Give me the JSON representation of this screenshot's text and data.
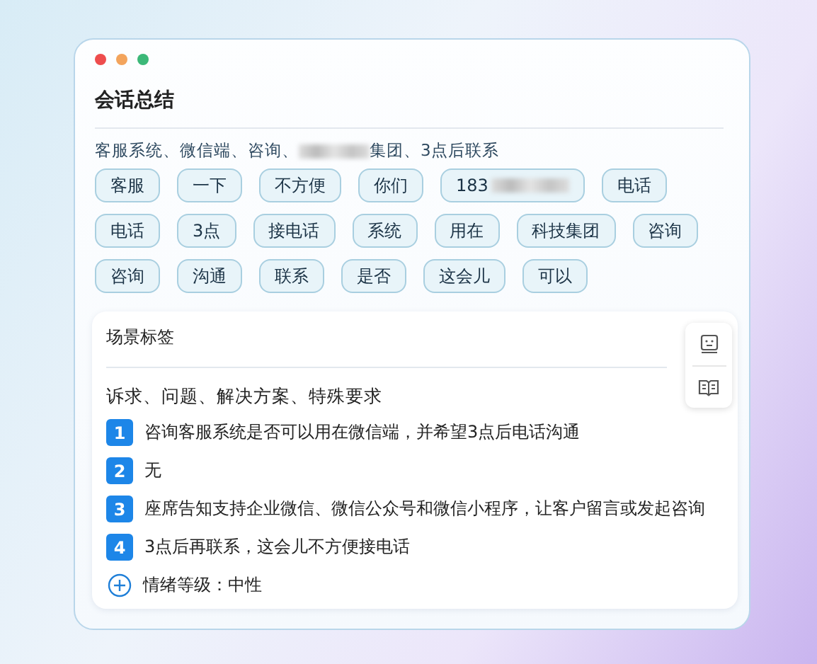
{
  "window": {
    "title": "会话总结"
  },
  "keywords": {
    "before": "客服系统、微信端、咨询、",
    "redacted": true,
    "after": "集团、3点后联系"
  },
  "chip_rows": [
    [
      {
        "text": "客服",
        "redacted": false
      },
      {
        "text": "一下",
        "redacted": false
      },
      {
        "text": "不方便",
        "redacted": false
      },
      {
        "text": "你们",
        "redacted": false
      },
      {
        "text": "183",
        "redacted": true
      },
      {
        "text": "电话",
        "redacted": false
      }
    ],
    [
      {
        "text": "电话",
        "redacted": false
      },
      {
        "text": "3点",
        "redacted": false
      },
      {
        "text": "接电话",
        "redacted": false
      },
      {
        "text": "系统",
        "redacted": false
      },
      {
        "text": "用在",
        "redacted": false
      },
      {
        "text": "科技集团",
        "redacted": false
      },
      {
        "text": "咨询",
        "redacted": false
      }
    ],
    [
      {
        "text": "咨询",
        "redacted": false
      },
      {
        "text": "沟通",
        "redacted": false
      },
      {
        "text": "联系",
        "redacted": false
      },
      {
        "text": "是否",
        "redacted": false
      },
      {
        "text": "这会儿",
        "redacted": false
      },
      {
        "text": "可以",
        "redacted": false
      }
    ]
  ],
  "scene_card": {
    "title": "场景标签",
    "subtitle": "诉求、问题、解决方案、特殊要求",
    "items": [
      {
        "kind": "numbered",
        "number": "1",
        "text": "咨询客服系统是否可以用在微信端，并希望3点后电话沟通"
      },
      {
        "kind": "numbered",
        "number": "2",
        "text": "无"
      },
      {
        "kind": "numbered",
        "number": "3",
        "text": "座席告知支持企业微信、微信公众号和微信小程序，让客户留言或发起咨询"
      },
      {
        "kind": "numbered",
        "number": "4",
        "text": "3点后再联系，这会儿不方便接电话"
      },
      {
        "kind": "add",
        "text": "情绪等级：中性"
      }
    ]
  }
}
